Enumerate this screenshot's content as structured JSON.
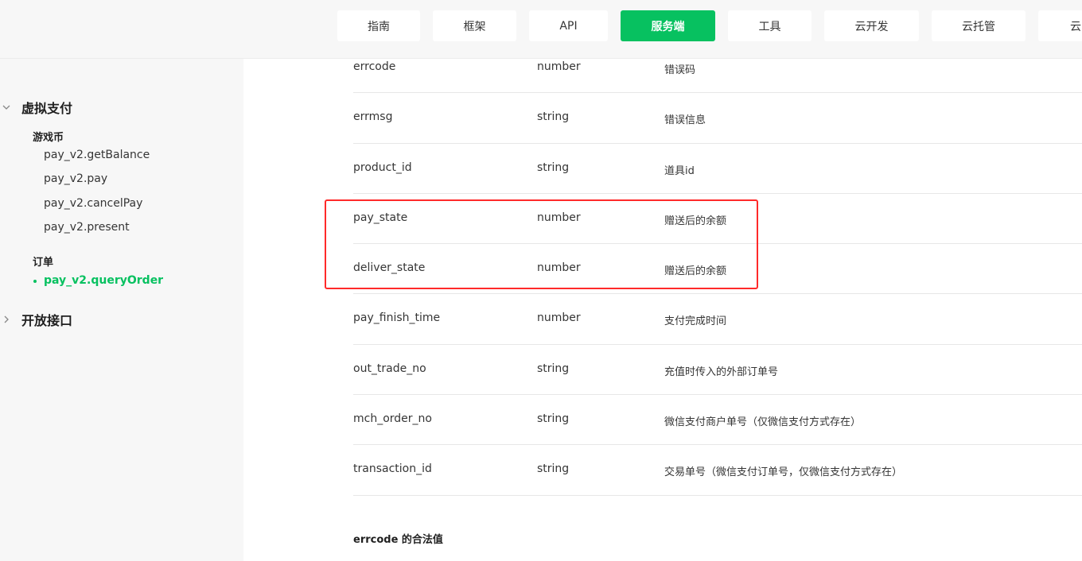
{
  "nav": {
    "tabs": [
      {
        "label": "指南"
      },
      {
        "label": "框架"
      },
      {
        "label": "API"
      },
      {
        "label": "服务端",
        "active": true
      },
      {
        "label": "工具"
      },
      {
        "label": "云开发"
      },
      {
        "label": "云托管"
      },
      {
        "label": "云"
      }
    ]
  },
  "sidebar": {
    "group_virtual_pay": "虚拟支付",
    "sub_game_coin": "游戏币",
    "items_game_coin": [
      "pay_v2.getBalance",
      "pay_v2.pay",
      "pay_v2.cancelPay",
      "pay_v2.present"
    ],
    "sub_order": "订单",
    "item_query_order": "pay_v2.queryOrder",
    "group_open_api": "开放接口"
  },
  "table": {
    "rows": [
      {
        "name": "errcode",
        "type": "number",
        "desc": "错误码"
      },
      {
        "name": "errmsg",
        "type": "string",
        "desc": "错误信息"
      },
      {
        "name": "product_id",
        "type": "string",
        "desc": "道具id"
      },
      {
        "name": "pay_state",
        "type": "number",
        "desc": "赠送后的余额"
      },
      {
        "name": "deliver_state",
        "type": "number",
        "desc": "赠送后的余额"
      },
      {
        "name": "pay_finish_time",
        "type": "number",
        "desc": "支付完成时间"
      },
      {
        "name": "out_trade_no",
        "type": "string",
        "desc": "充值时传入的外部订单号"
      },
      {
        "name": "mch_order_no",
        "type": "string",
        "desc": "微信支付商户单号（仅微信支付方式存在）"
      },
      {
        "name": "transaction_id",
        "type": "string",
        "desc": "交易单号（微信支付订单号，仅微信支付方式存在）"
      }
    ]
  },
  "section": {
    "errcode_title": "errcode 的合法值"
  },
  "colors": {
    "accent": "#07c160",
    "highlight": "#ff2a2a"
  }
}
